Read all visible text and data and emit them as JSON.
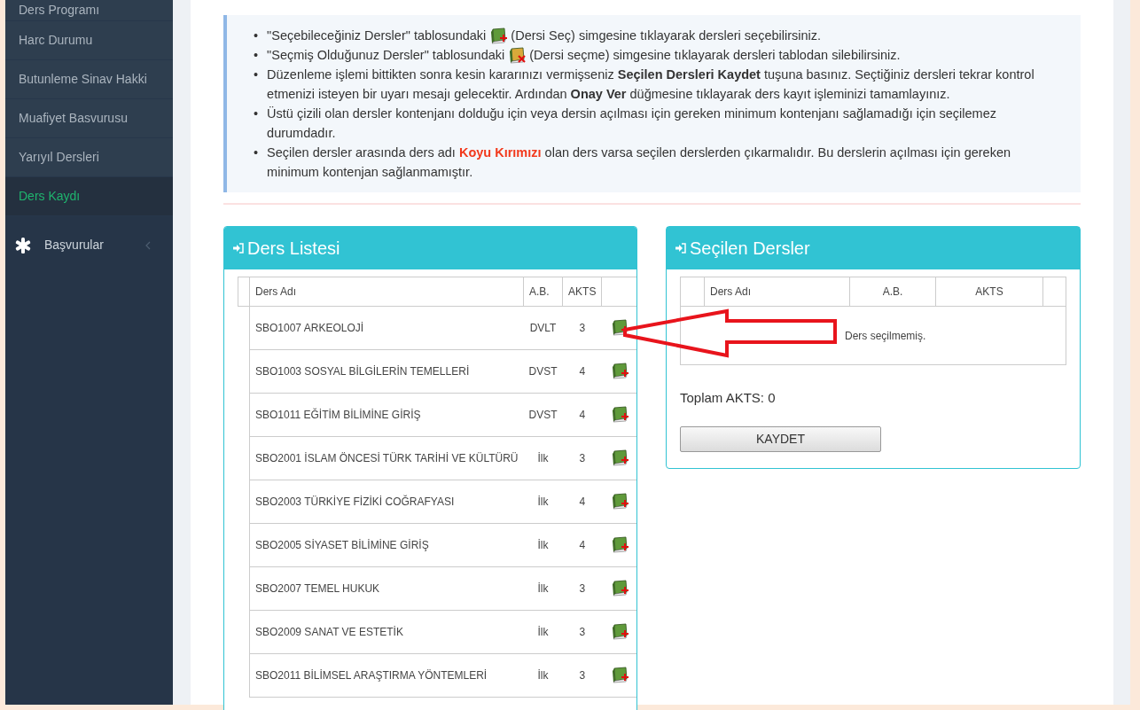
{
  "sidebar": {
    "items": [
      {
        "label": "Ders Programı",
        "selected": false
      },
      {
        "label": "Harc Durumu",
        "selected": false
      },
      {
        "label": "Butunleme Sinav Hakki",
        "selected": false
      },
      {
        "label": "Muafiyet Basvurusu",
        "selected": false
      },
      {
        "label": "Yarıyıl Dersleri",
        "selected": false
      },
      {
        "label": "Ders Kaydı",
        "selected": true
      }
    ],
    "section": {
      "label": "Başvurular",
      "expanded": false
    }
  },
  "instructions": [
    {
      "kind": "add_icon",
      "marker": "•",
      "before": "\"Seçebileceğiniz Dersler\" tablosundaki",
      "after": "(Dersi Seç) simgesine tıklayarak dersleri seçebilirsiniz."
    },
    {
      "kind": "remove_icon",
      "marker": "•",
      "before": "\"Seçmiş Olduğunuz Dersler\" tablosundaki",
      "after": "(Dersi seçme) simgesine tıklayarak dersleri tablodan silebilirsiniz."
    },
    {
      "kind": "text",
      "marker": "•",
      "text": "Düzenleme işlemi bittikten sonra kesin kararınızı vermişseniz **Seçilen Dersleri Kaydet** tuşuna basınız. Seçtiğiniz dersleri tekrar kontrol etmenizi isteyen bir uyarı mesajı gelecektir. Ardından **Onay Ver** düğmesine tıklayarak ders kayıt işleminizi tamamlayınız."
    },
    {
      "kind": "text",
      "marker": "•",
      "text": "Üstü çizili olan dersler kontenjanı dolduğu için veya dersin açılması için gereken minimum kontenjanı sağlamadığı için seçilemez durumdadır."
    },
    {
      "kind": "warning",
      "marker": "•",
      "text": "Seçilen dersler arasında ders adı **Koyu Kırımızı** olan ders varsa seçilen derslerden çıkarmalıdır. Bu derslerin açılması için gereken minimum kontenjan sağlanmamıştır."
    }
  ],
  "course_list": {
    "title": "Ders Listesi",
    "columns": [
      "Ders Adı",
      "A.B.",
      "AKTS"
    ],
    "rows": [
      {
        "name": "SBO1007 ARKEOLOJİ",
        "ab": "DVLT",
        "akts": "3"
      },
      {
        "name": "SBO1003 SOSYAL BİLGİLERİN TEMELLERİ",
        "ab": "DVST",
        "akts": "4"
      },
      {
        "name": "SBO1011 EĞİTİM BİLİMİNE GİRİŞ",
        "ab": "DVST",
        "akts": "4"
      },
      {
        "name": "SBO2001 İSLAM ÖNCESİ TÜRK TARİHİ VE KÜLTÜRÜ",
        "ab": "İlk",
        "akts": "3"
      },
      {
        "name": "SBO2003 TÜRKİYE FİZİKİ COĞRAFYASI",
        "ab": "İlk",
        "akts": "4"
      },
      {
        "name": "SBO2005 SİYASET BİLİMİNE GİRİŞ",
        "ab": "İlk",
        "akts": "4"
      },
      {
        "name": "SBO2007 TEMEL HUKUK",
        "ab": "İlk",
        "akts": "3"
      },
      {
        "name": "SBO2009 SANAT VE ESTETİK",
        "ab": "İlk",
        "akts": "3"
      },
      {
        "name": "SBO2011 BİLİMSEL ARAŞTIRMA YÖNTEMLERİ",
        "ab": "İlk",
        "akts": "3"
      }
    ]
  },
  "selected_courses": {
    "title": "Seçilen Dersler",
    "columns": [
      "Ders Adı",
      "A.B.",
      "AKTS"
    ],
    "empty_message": "Ders seçilmemiş.",
    "total": "Toplam AKTS: 0",
    "button": "KAYDET"
  }
}
